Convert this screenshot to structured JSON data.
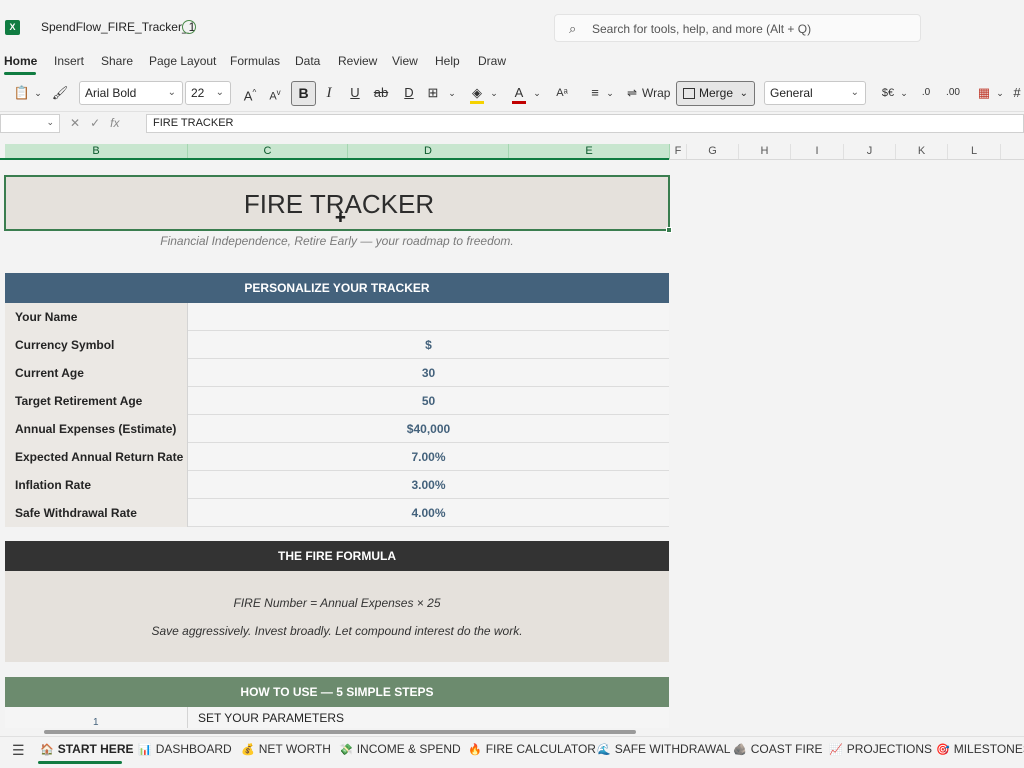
{
  "window": {
    "doc_title": "SpendFlow_FIRE_Tracker_1",
    "search_placeholder": "Search for tools, help, and more (Alt + Q)"
  },
  "menu": {
    "tabs": [
      "Home",
      "Insert",
      "Share",
      "Page Layout",
      "Formulas",
      "Data",
      "Review",
      "View",
      "Help",
      "Draw"
    ]
  },
  "ribbon": {
    "font_name": "Arial Bold",
    "font_size": "22",
    "wrap_label": "Wrap",
    "merge_label": "Merge",
    "number_format": "General"
  },
  "formula_bar": {
    "content": "FIRE TRACKER"
  },
  "columns": [
    "B",
    "C",
    "D",
    "E",
    "F",
    "G",
    "H",
    "I",
    "J",
    "K",
    "L"
  ],
  "sheet": {
    "title": "FIRE TRACKER",
    "subtitle": "Financial Independence, Retire Early — your roadmap to freedom.",
    "personalize_header": "PERSONALIZE YOUR TRACKER",
    "params": [
      {
        "label": "Your Name",
        "value": ""
      },
      {
        "label": "Currency Symbol",
        "value": "$"
      },
      {
        "label": "Current Age",
        "value": "30"
      },
      {
        "label": "Target Retirement Age",
        "value": "50"
      },
      {
        "label": "Annual Expenses (Estimate)",
        "value": "$40,000"
      },
      {
        "label": "Expected Annual Return Rate",
        "value": "7.00%"
      },
      {
        "label": "Inflation Rate",
        "value": "3.00%"
      },
      {
        "label": "Safe Withdrawal Rate",
        "value": "4.00%"
      }
    ],
    "formula_header": "THE FIRE FORMULA",
    "formula_line1": "FIRE Number  =  Annual Expenses  ×  25",
    "formula_line2": "Save aggressively. Invest broadly. Let compound interest do the work.",
    "howto_header": "HOW TO USE — 5 SIMPLE STEPS",
    "step1_num": "1",
    "step1_label": "SET YOUR PARAMETERS"
  },
  "sheet_tabs": [
    {
      "label": "START HERE",
      "icon": "house-icon",
      "glyph": "🏠"
    },
    {
      "label": "DASHBOARD",
      "icon": "chart-icon",
      "glyph": "📊"
    },
    {
      "label": "NET WORTH",
      "icon": "moneybag-icon",
      "glyph": "💰"
    },
    {
      "label": "INCOME & SPEND",
      "icon": "money-icon",
      "glyph": "💸"
    },
    {
      "label": "FIRE CALCULATOR",
      "icon": "fire-icon",
      "glyph": "🔥"
    },
    {
      "label": "SAFE WITHDRAWAL",
      "icon": "wave-icon",
      "glyph": "🌊"
    },
    {
      "label": "COAST FIRE",
      "icon": "rock-icon",
      "glyph": "🪨"
    },
    {
      "label": "PROJECTIONS",
      "icon": "trend-icon",
      "glyph": "📈"
    },
    {
      "label": "MILESTONES",
      "icon": "target-icon",
      "glyph": "🎯"
    }
  ],
  "colors": {
    "accent": "#107c41",
    "blue_band": "#44627c",
    "dark_band": "#333333",
    "green_band": "#6c8b6e",
    "title_bg": "#e5e1dc"
  }
}
